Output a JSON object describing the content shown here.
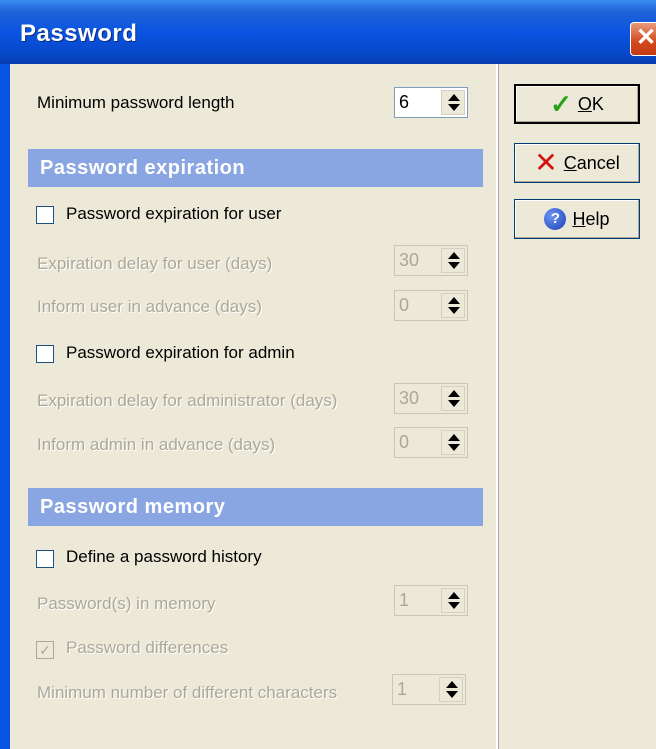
{
  "window": {
    "title": "Password",
    "close_glyph": "✕"
  },
  "fields": {
    "min_length": {
      "label": "Minimum password length",
      "value": "6"
    }
  },
  "expiration": {
    "heading": "Password expiration",
    "user_checkbox": "Password expiration for user",
    "user_delay": {
      "label": "Expiration delay for user (days)",
      "value": "30"
    },
    "user_inform": {
      "label": "Inform user in advance (days)",
      "value": "0"
    },
    "admin_checkbox": "Password expiration for admin",
    "admin_delay": {
      "label": "Expiration delay for administrator (days)",
      "value": "30"
    },
    "admin_inform": {
      "label": "Inform admin in advance (days)",
      "value": "0"
    }
  },
  "memory": {
    "heading": "Password memory",
    "history_checkbox": "Define a password history",
    "in_memory": {
      "label": "Password(s) in memory",
      "value": "1"
    },
    "differences_checkbox": "Password differences",
    "min_diff_chars": {
      "label": "Minimum number of different characters",
      "value": "1"
    }
  },
  "buttons": {
    "ok": {
      "accel": "O",
      "rest": "K",
      "icon": "✓"
    },
    "cancel": {
      "accel": "C",
      "rest": "ancel",
      "icon": "✕"
    },
    "help": {
      "accel": "H",
      "rest": "elp",
      "icon": "?"
    }
  },
  "checked_glyph": "✓",
  "colors": {
    "title_bar": "#0a54e2",
    "section_header": "#8aa6e2",
    "dialog_bg": "#ece9d8",
    "disabled_text": "#aca899"
  }
}
